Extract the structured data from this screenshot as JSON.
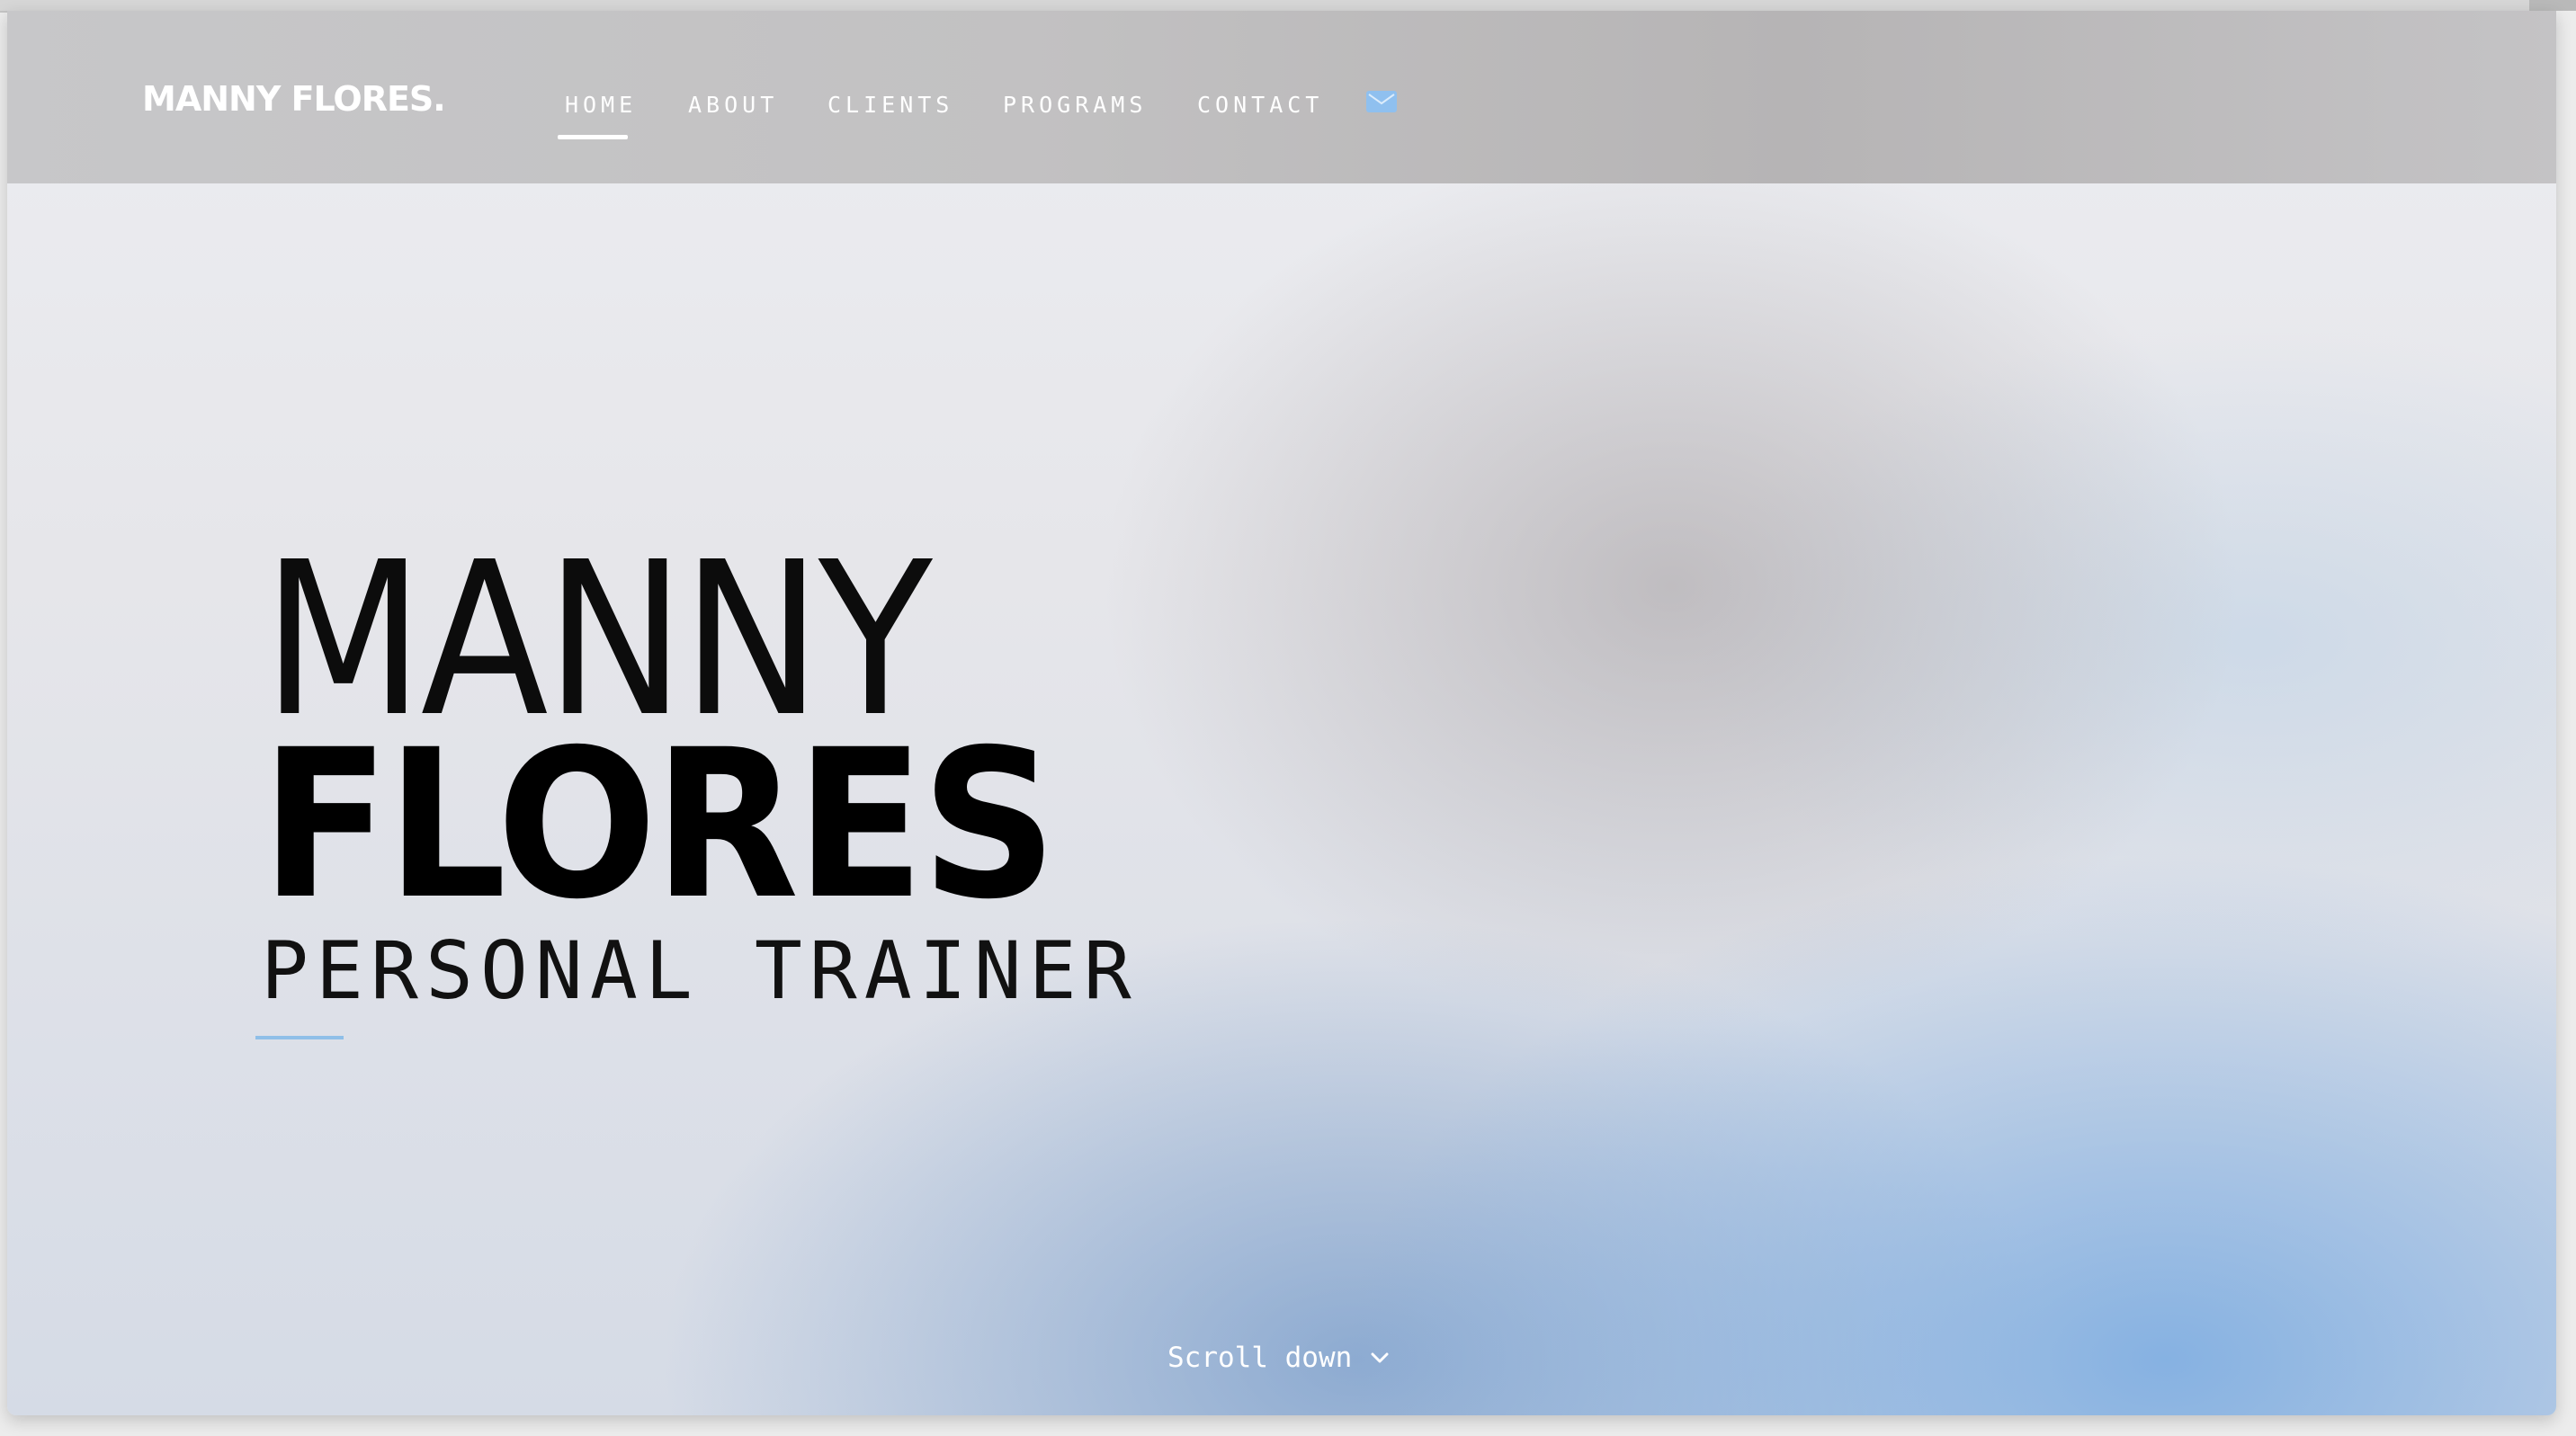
{
  "header": {
    "brand": "MANNY FLORES.",
    "nav": [
      {
        "label": "HOME",
        "active": true
      },
      {
        "label": "ABOUT"
      },
      {
        "label": "CLIENTS"
      },
      {
        "label": "PROGRAMS"
      },
      {
        "label": "CONTACT"
      }
    ],
    "mail_icon": "envelope-icon",
    "accent_color": "#8fc0ef"
  },
  "hero": {
    "first_name": "MANNY",
    "last_name": "FLORES",
    "role": "PERSONAL TRAINER"
  },
  "scroll": {
    "label": "Scroll down",
    "icon": "chevron-down-icon"
  }
}
